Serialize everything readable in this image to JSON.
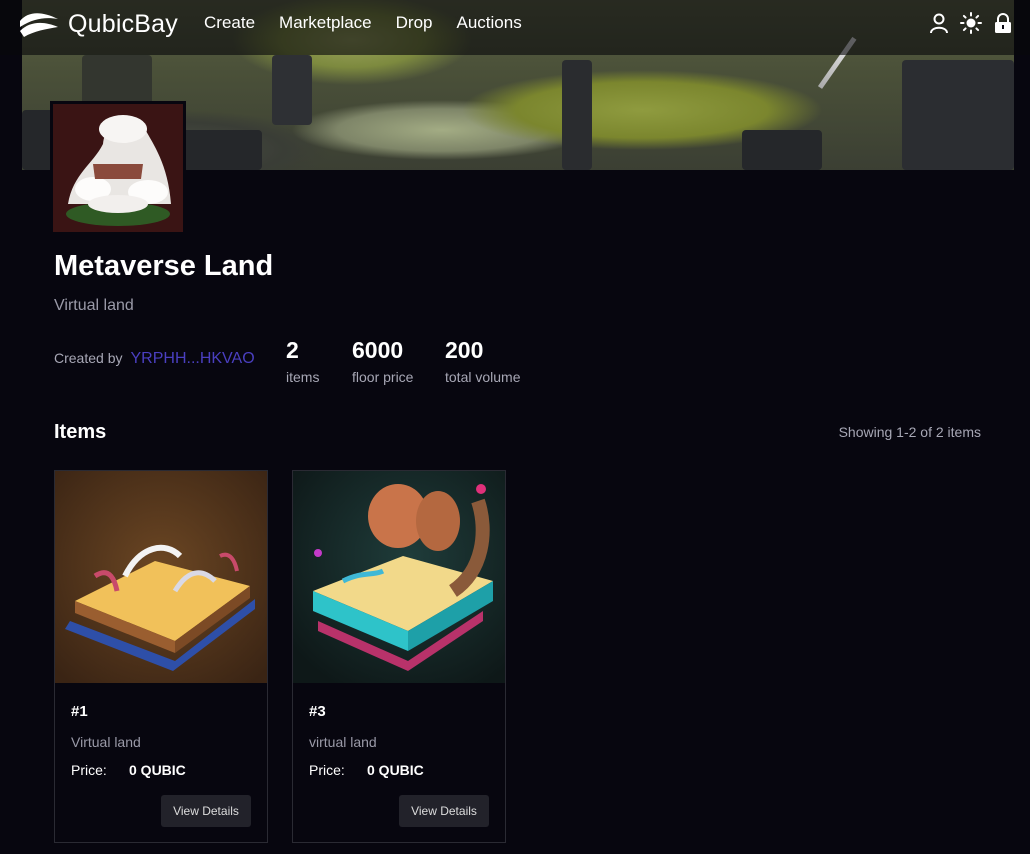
{
  "nav": {
    "brand": "QubicBay",
    "links": [
      "Create",
      "Marketplace",
      "Drop",
      "Auctions"
    ],
    "icons": [
      "user-icon",
      "sun-icon",
      "lock-icon"
    ]
  },
  "collection": {
    "title": "Metaverse Land",
    "subtitle": "Virtual land",
    "created_by_label": "Created by",
    "creator": "YRPHH...HKVAO",
    "stats": [
      {
        "value": "2",
        "label": "items"
      },
      {
        "value": "6000",
        "label": "floor price"
      },
      {
        "value": "200",
        "label": "total volume"
      }
    ]
  },
  "items_section": {
    "heading": "Items",
    "showing": "Showing 1-2 of 2 items"
  },
  "items": [
    {
      "title": "#1",
      "desc": "Virtual land",
      "price_label": "Price:",
      "price": "0 QUBIC",
      "button": "View Details"
    },
    {
      "title": "#3",
      "desc": "virtual land",
      "price_label": "Price:",
      "price": "0 QUBIC",
      "button": "View Details"
    }
  ],
  "colors": {
    "background": "#07060f",
    "accent_link": "#4a3fc0",
    "muted_text": "#a7a7b5"
  }
}
